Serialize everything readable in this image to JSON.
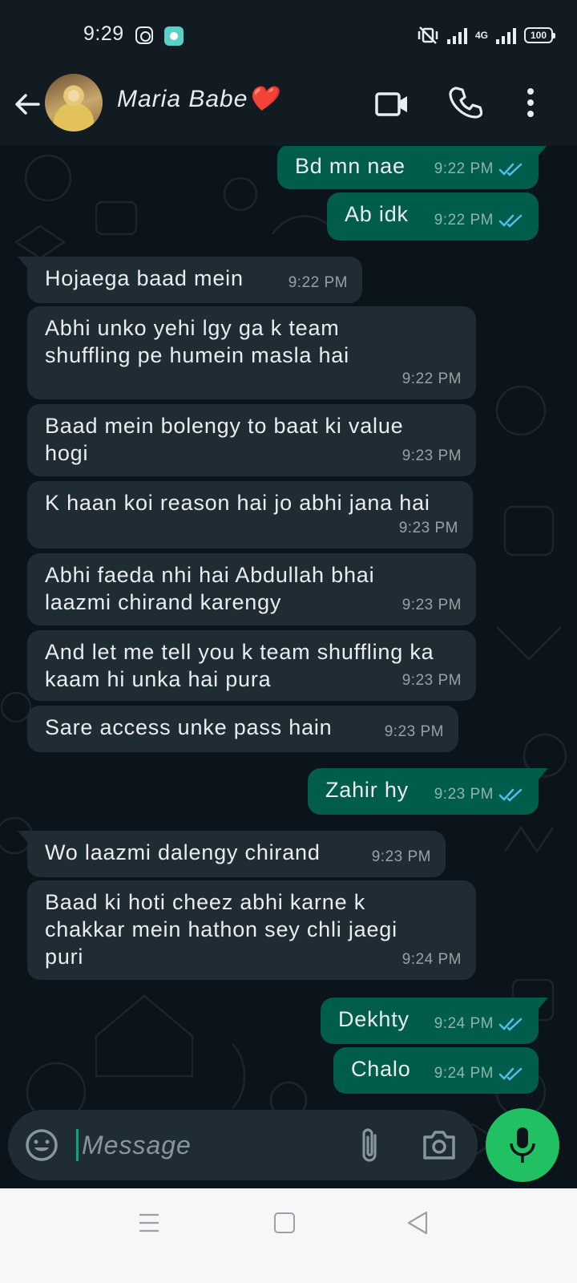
{
  "status_bar": {
    "time": "9:29",
    "network": "4G",
    "battery": "100"
  },
  "header": {
    "contact_name": "Maria Babe❤️"
  },
  "messages": [
    {
      "dir": "out",
      "text": "Bd mn nae",
      "time": "9:22 PM",
      "read": true
    },
    {
      "dir": "out",
      "text": "Ab idk",
      "time": "9:22 PM",
      "read": true
    },
    {
      "dir": "in",
      "text": "Hojaega baad mein",
      "time": "9:22 PM"
    },
    {
      "dir": "in",
      "text": "Abhi unko yehi lgy ga k team shuffling pe humein masla hai",
      "time": "9:22 PM"
    },
    {
      "dir": "in",
      "text": "Baad mein bolengy to baat ki value hogi",
      "time": "9:23 PM"
    },
    {
      "dir": "in",
      "text": "K haan koi reason hai jo abhi jana hai",
      "time": "9:23 PM"
    },
    {
      "dir": "in",
      "text": "Abhi faeda nhi hai Abdullah bhai laazmi chirand karengy",
      "time": "9:23 PM"
    },
    {
      "dir": "in",
      "text": "And let me tell you k team shuffling ka kaam hi unka hai pura",
      "time": "9:23 PM"
    },
    {
      "dir": "in",
      "text": "Sare access unke pass hain",
      "time": "9:23 PM"
    },
    {
      "dir": "out",
      "text": "Zahir hy",
      "time": "9:23 PM",
      "read": true
    },
    {
      "dir": "in",
      "text": "Wo laazmi dalengy chirand",
      "time": "9:23 PM"
    },
    {
      "dir": "in",
      "text": "Baad ki hoti cheez abhi karne k chakkar mein hathon sey chli jaegi puri",
      "time": "9:24 PM"
    },
    {
      "dir": "out",
      "text": "Dekhty",
      "time": "9:24 PM",
      "read": true
    },
    {
      "dir": "out",
      "text": "Chalo",
      "time": "9:24 PM",
      "read": true
    }
  ],
  "composer": {
    "placeholder": "Message"
  },
  "icons": {
    "back": "arrow-left-icon",
    "video": "video-call-icon",
    "call": "phone-icon",
    "more": "more-vert-icon",
    "emoji": "emoji-icon",
    "attach": "paperclip-icon",
    "camera": "camera-icon",
    "mic": "mic-icon"
  },
  "colors": {
    "background": "#0b141a",
    "incoming_bubble": "#202c33",
    "outgoing_bubble": "#005c4b",
    "read_tick": "#53bdeb",
    "mic_button": "#21c063",
    "header": "#111b21"
  }
}
